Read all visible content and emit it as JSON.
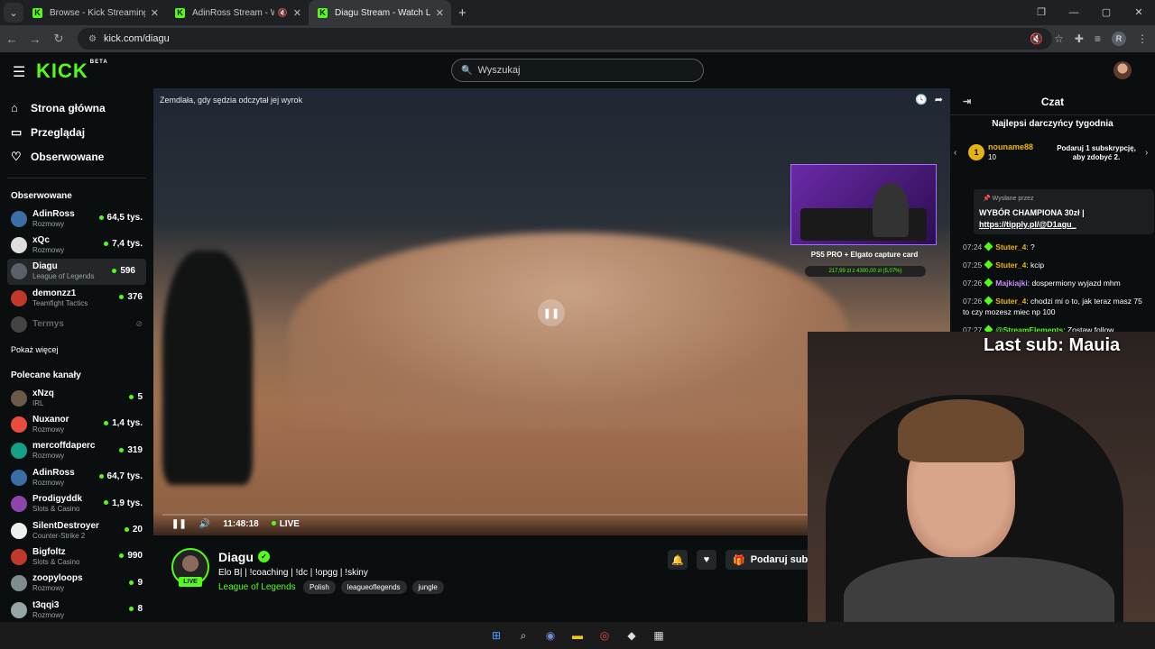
{
  "browser": {
    "tabs": [
      {
        "title": "Browse - Kick Streaming"
      },
      {
        "title": "AdinRoss Stream - Watch Li"
      },
      {
        "title": "Diagu Stream - Watch Live on K"
      }
    ],
    "url": "kick.com/diagu",
    "profile_initial": "R"
  },
  "header": {
    "logo": "KICK",
    "logo_badge": "BETA",
    "search_placeholder": "Wyszukaj"
  },
  "sidebar": {
    "nav": [
      {
        "label": "Strona główna",
        "icon": "home-icon"
      },
      {
        "label": "Przeglądaj",
        "icon": "browse-icon"
      },
      {
        "label": "Obserwowane",
        "icon": "heart-icon"
      }
    ],
    "followed_title": "Obserwowane",
    "followed": [
      {
        "name": "AdinRoss",
        "category": "Rozmowy",
        "viewers": "64,5 tys.",
        "color": "#3b6ea5"
      },
      {
        "name": "xQc",
        "category": "Rozmowy",
        "viewers": "7,4 tys.",
        "color": "#dddddd"
      },
      {
        "name": "Diagu",
        "category": "League of Legends",
        "viewers": "596",
        "color": "#5a5f6a"
      },
      {
        "name": "demonzz1",
        "category": "Teamfight Tactics",
        "viewers": "376",
        "color": "#c0392b"
      },
      {
        "name": "Termys",
        "category": "",
        "viewers": "",
        "color": "#444444"
      }
    ],
    "show_more": "Pokaż więcej",
    "recommended_title": "Polecane kanały",
    "recommended": [
      {
        "name": "xNzq",
        "category": "IRL",
        "viewers": "5",
        "color": "#6b5a4a"
      },
      {
        "name": "Nuxanor",
        "category": "Rozmowy",
        "viewers": "1,4 tys.",
        "color": "#e74c3c"
      },
      {
        "name": "mercoffdaperc",
        "category": "Rozmowy",
        "viewers": "319",
        "color": "#16a085"
      },
      {
        "name": "AdinRoss",
        "category": "Rozmowy",
        "viewers": "64,7 tys.",
        "color": "#3b6ea5"
      },
      {
        "name": "Prodigyddk",
        "category": "Slots & Casino",
        "viewers": "1,9 tys.",
        "color": "#8e44ad"
      },
      {
        "name": "SilentDestroyer",
        "category": "Counter-Strike 2",
        "viewers": "20",
        "color": "#eeeeee"
      },
      {
        "name": "Bigfoltz",
        "category": "Slots & Casino",
        "viewers": "990",
        "color": "#c0392b"
      },
      {
        "name": "zoopyloops",
        "category": "Rozmowy",
        "viewers": "9",
        "color": "#7f8c8d"
      },
      {
        "name": "t3qqi3",
        "category": "Rozmowy",
        "viewers": "8",
        "color": "#95a5a6"
      }
    ]
  },
  "video": {
    "overlay_title": "Zemdlała, gdy sędzia odczytał jej wyrok",
    "pip_label": "PS5 PRO + Elgato capture card",
    "pip_bar": "217,99 zł z 4300,00 zł (5,07%)",
    "time": "11:48:18",
    "live_label": "LIVE"
  },
  "stream": {
    "name": "Diagu",
    "title": "Elo B| | !coaching | !dc | !opgg | !skiny",
    "category": "League of Legends",
    "tags": [
      "Polish",
      "leagueoflegends",
      "jungle"
    ],
    "live_tag": "LIVE",
    "sub_button": "Podaruj subs"
  },
  "chat": {
    "title": "Czat",
    "gifters_title": "Najlepsi darczyńcy tygodnia",
    "top_gifter": {
      "rank": "1",
      "name": "nouname88",
      "count": "10"
    },
    "next_gift": "Podaruj 1 subskrypcję, aby zdobyć 2.",
    "pinned_meta": "Wysłane przez",
    "pinned_text": "WYBÓR CHAMPIONA 30zł |",
    "pinned_link": "https://tipply.pl/@D1agu_",
    "messages": [
      {
        "time": "07:24",
        "user": "Stuter_4",
        "color": "#f0b400",
        "text": "?"
      },
      {
        "time": "07:25",
        "user": "Stuter_4",
        "color": "#f0b400",
        "text": "kcip"
      },
      {
        "time": "07:26",
        "user": "Majkiajki",
        "color": "#c78bff",
        "text": "dospermiony wyjazd mhm"
      },
      {
        "time": "07:26",
        "user": "Stuter_4",
        "color": "#f0b400",
        "text": "chodzi mi o to, jak teraz masz 75 to czy mozesz miec np 100"
      },
      {
        "time": "07:27",
        "user": "@StreamElements",
        "color": "#53fc18",
        "text": "Zostaw follow"
      }
    ]
  },
  "overlay": {
    "last_sub": "Last sub: Mauia"
  }
}
